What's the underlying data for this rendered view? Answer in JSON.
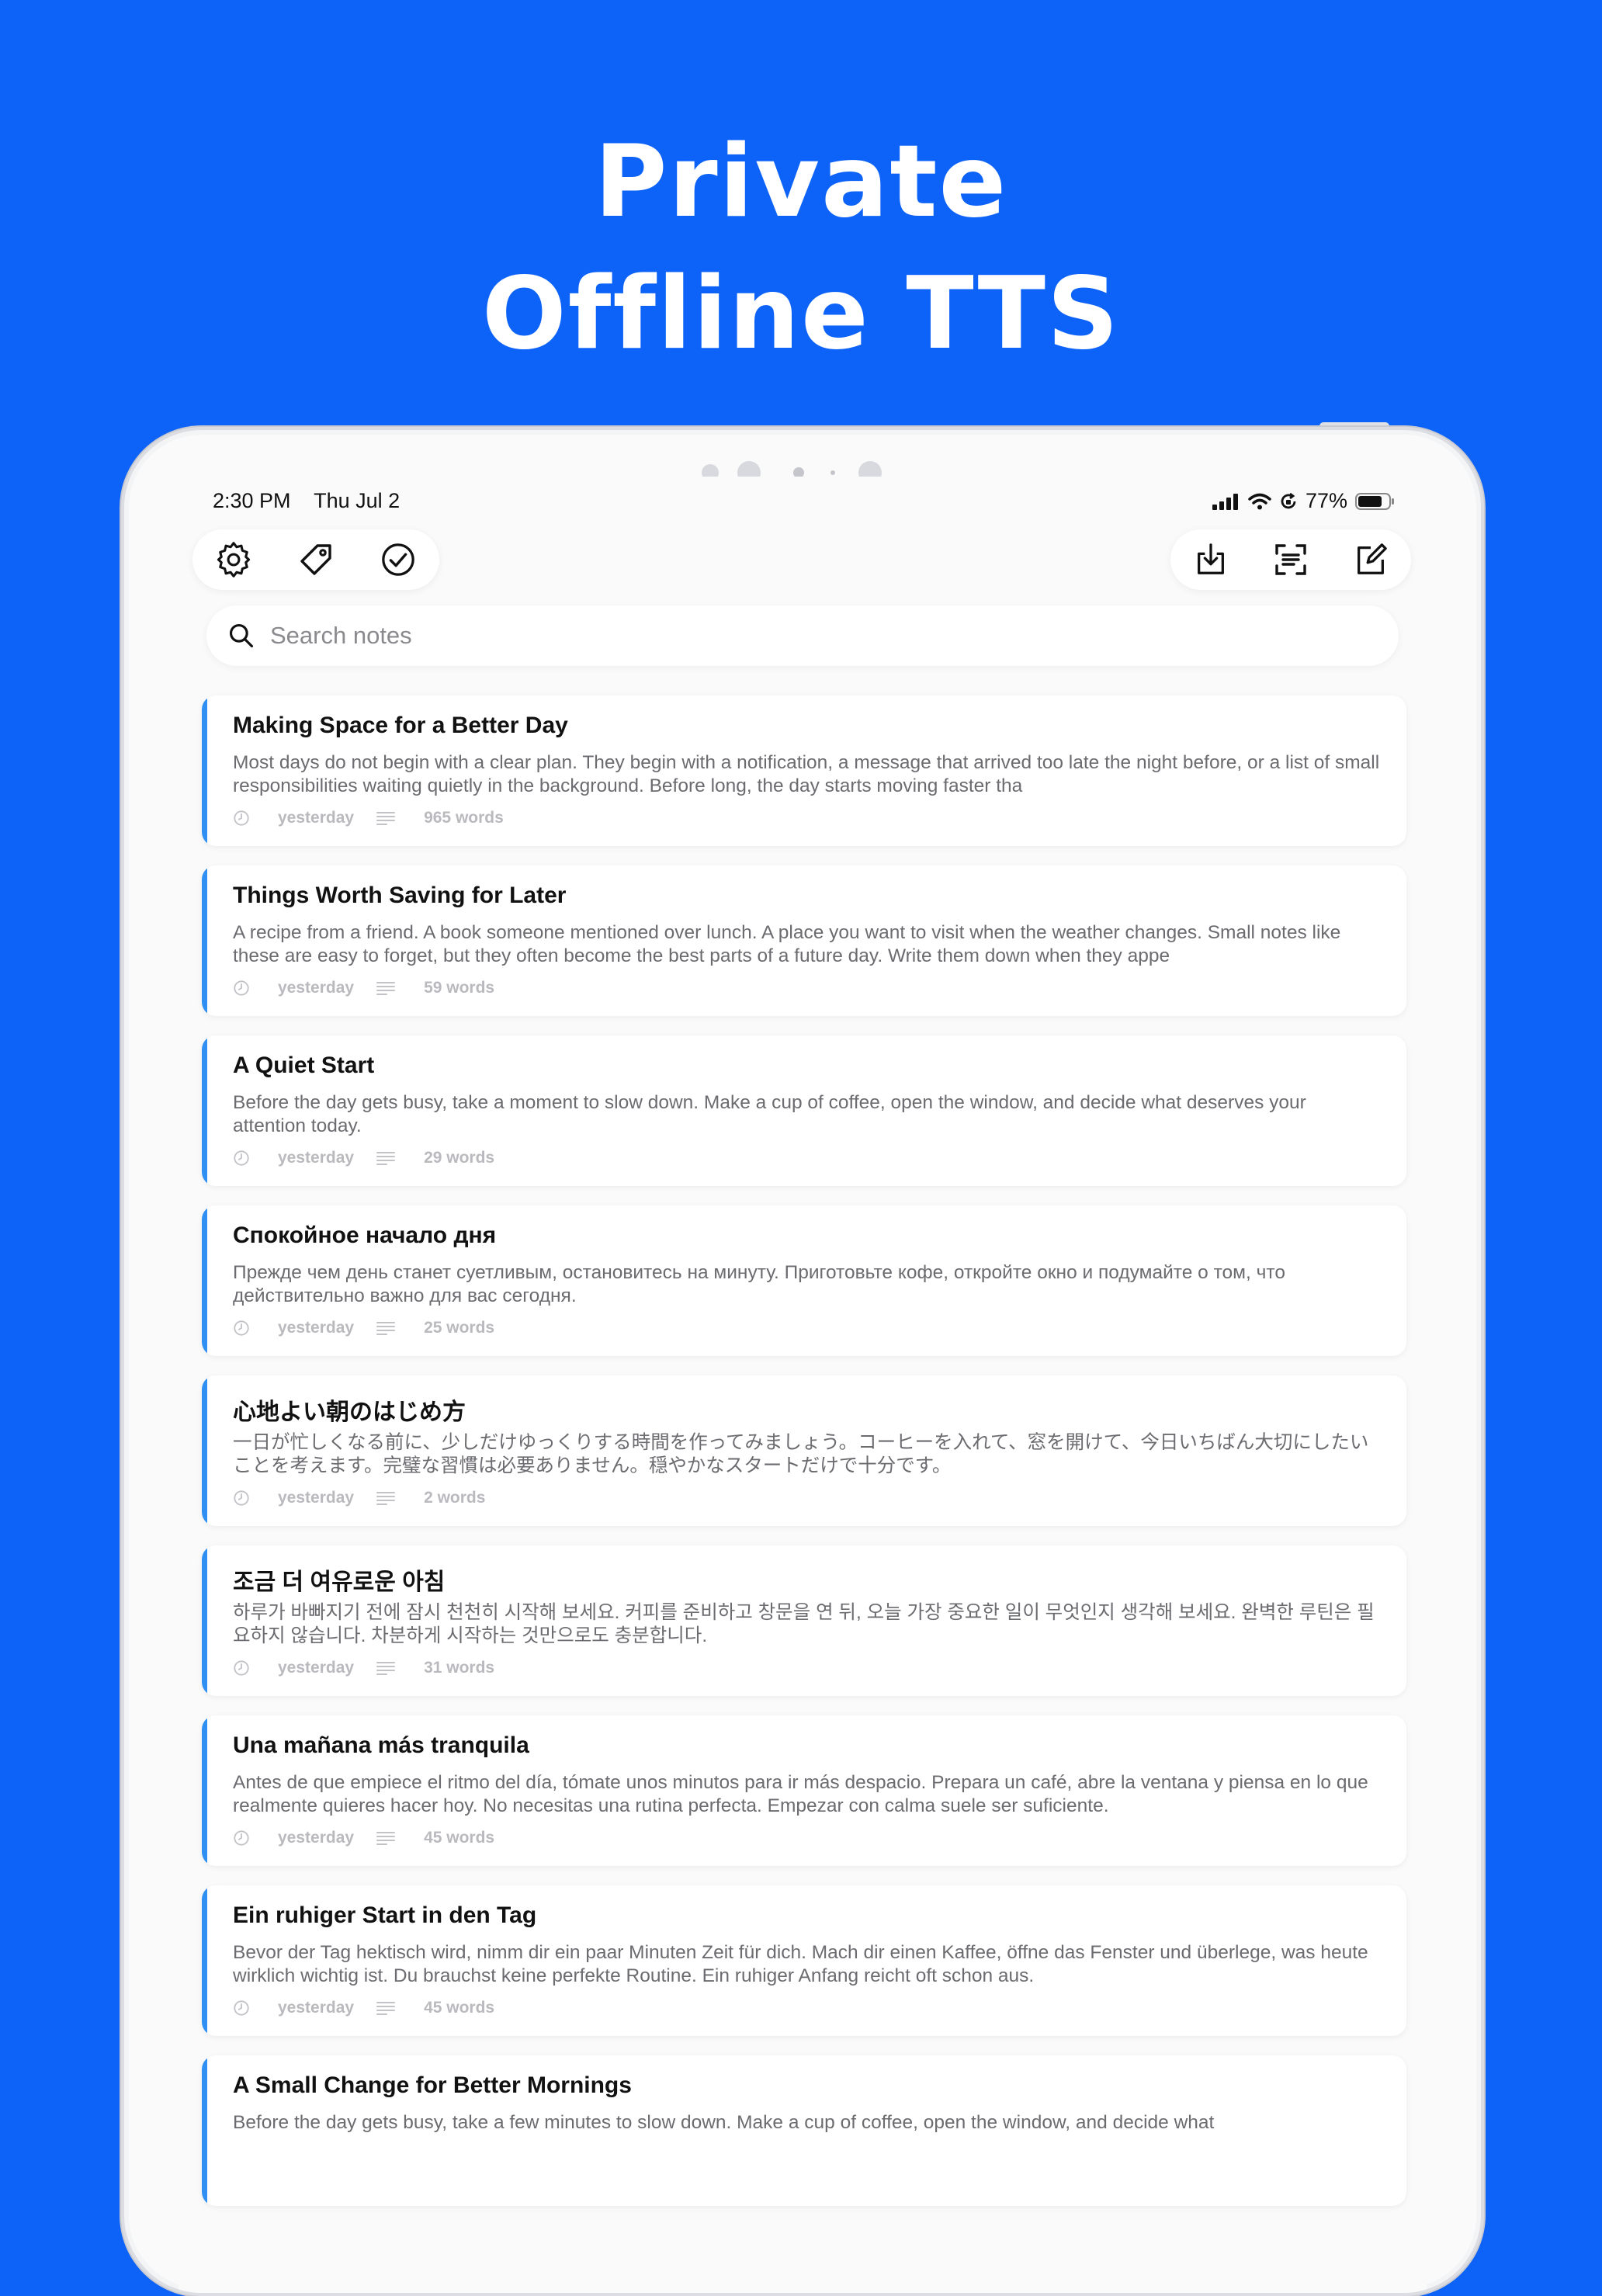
{
  "headline": {
    "line1": "Private",
    "line2": "Offline TTS"
  },
  "status_bar": {
    "time": "2:30 PM",
    "date": "Thu Jul 2",
    "battery": "77%"
  },
  "toolbar": {
    "left": [
      "settings-icon",
      "tag-icon",
      "check-circle-icon"
    ],
    "right": [
      "import-icon",
      "scan-text-icon",
      "compose-icon"
    ]
  },
  "search": {
    "placeholder": "Search notes",
    "value": ""
  },
  "colors": {
    "background": "#0d62f7",
    "accent": "#2f8ff3"
  },
  "notes": [
    {
      "title": "Making Space for a Better Day",
      "preview": "Most days do not begin with a clear plan. They begin with a notification, a message that arrived too late the night before, or a list of small responsibilities waiting quietly in the background. Before long, the day starts moving faster tha",
      "date": "yesterday",
      "words": "965 words"
    },
    {
      "title": "Things Worth Saving for Later",
      "preview": "A recipe from a friend. A book someone mentioned over lunch. A place you want to visit when the weather changes. Small notes like these are easy to forget, but they often become the best parts of a future day. Write them down when they appe",
      "date": "yesterday",
      "words": "59 words"
    },
    {
      "title": "A Quiet Start",
      "preview": "Before the day gets busy, take a moment to slow down. Make a cup of coffee, open the window, and decide what deserves your attention today.",
      "date": "yesterday",
      "words": "29 words"
    },
    {
      "title": "Спокойное начало дня",
      "preview": "Прежде чем день станет суетливым, остановитесь на минуту. Приготовьте кофе, откройте окно и подумайте о том, что действительно важно для вас сегодня.",
      "date": "yesterday",
      "words": "25 words"
    },
    {
      "title": "心地よい朝のはじめ方",
      "preview": "一日が忙しくなる前に、少しだけゆっくりする時間を作ってみましょう。コーヒーを入れて、窓を開けて、今日いちばん大切にしたいことを考えます。完璧な習慣は必要ありません。穏やかなスタートだけで十分です。",
      "date": "yesterday",
      "words": "2 words"
    },
    {
      "title": "조금 더 여유로운 아침",
      "preview": "하루가 바빠지기 전에 잠시 천천히 시작해 보세요. 커피를 준비하고 창문을 연 뒤, 오늘 가장 중요한 일이 무엇인지 생각해 보세요. 완벽한 루틴은 필요하지 않습니다. 차분하게 시작하는 것만으로도 충분합니다.",
      "date": "yesterday",
      "words": "31 words"
    },
    {
      "title": "Una mañana más tranquila",
      "preview": "Antes de que empiece el ritmo del día, tómate unos minutos para ir más despacio. Prepara un café, abre la ventana y piensa en lo que realmente quieres hacer hoy. No necesitas una rutina perfecta. Empezar con calma suele ser suficiente.",
      "date": "yesterday",
      "words": "45 words"
    },
    {
      "title": "Ein ruhiger Start in den Tag",
      "preview": "Bevor der Tag hektisch wird, nimm dir ein paar Minuten Zeit für dich. Mach dir einen Kaffee, öffne das Fenster und überlege, was heute wirklich wichtig ist. Du brauchst keine perfekte Routine. Ein ruhiger Anfang reicht oft schon aus.",
      "date": "yesterday",
      "words": "45 words"
    },
    {
      "title": "A Small Change for Better Mornings",
      "preview": "Before the day gets busy, take a few minutes to slow down. Make a cup of coffee, open the window, and decide what",
      "date": "",
      "words": ""
    }
  ]
}
